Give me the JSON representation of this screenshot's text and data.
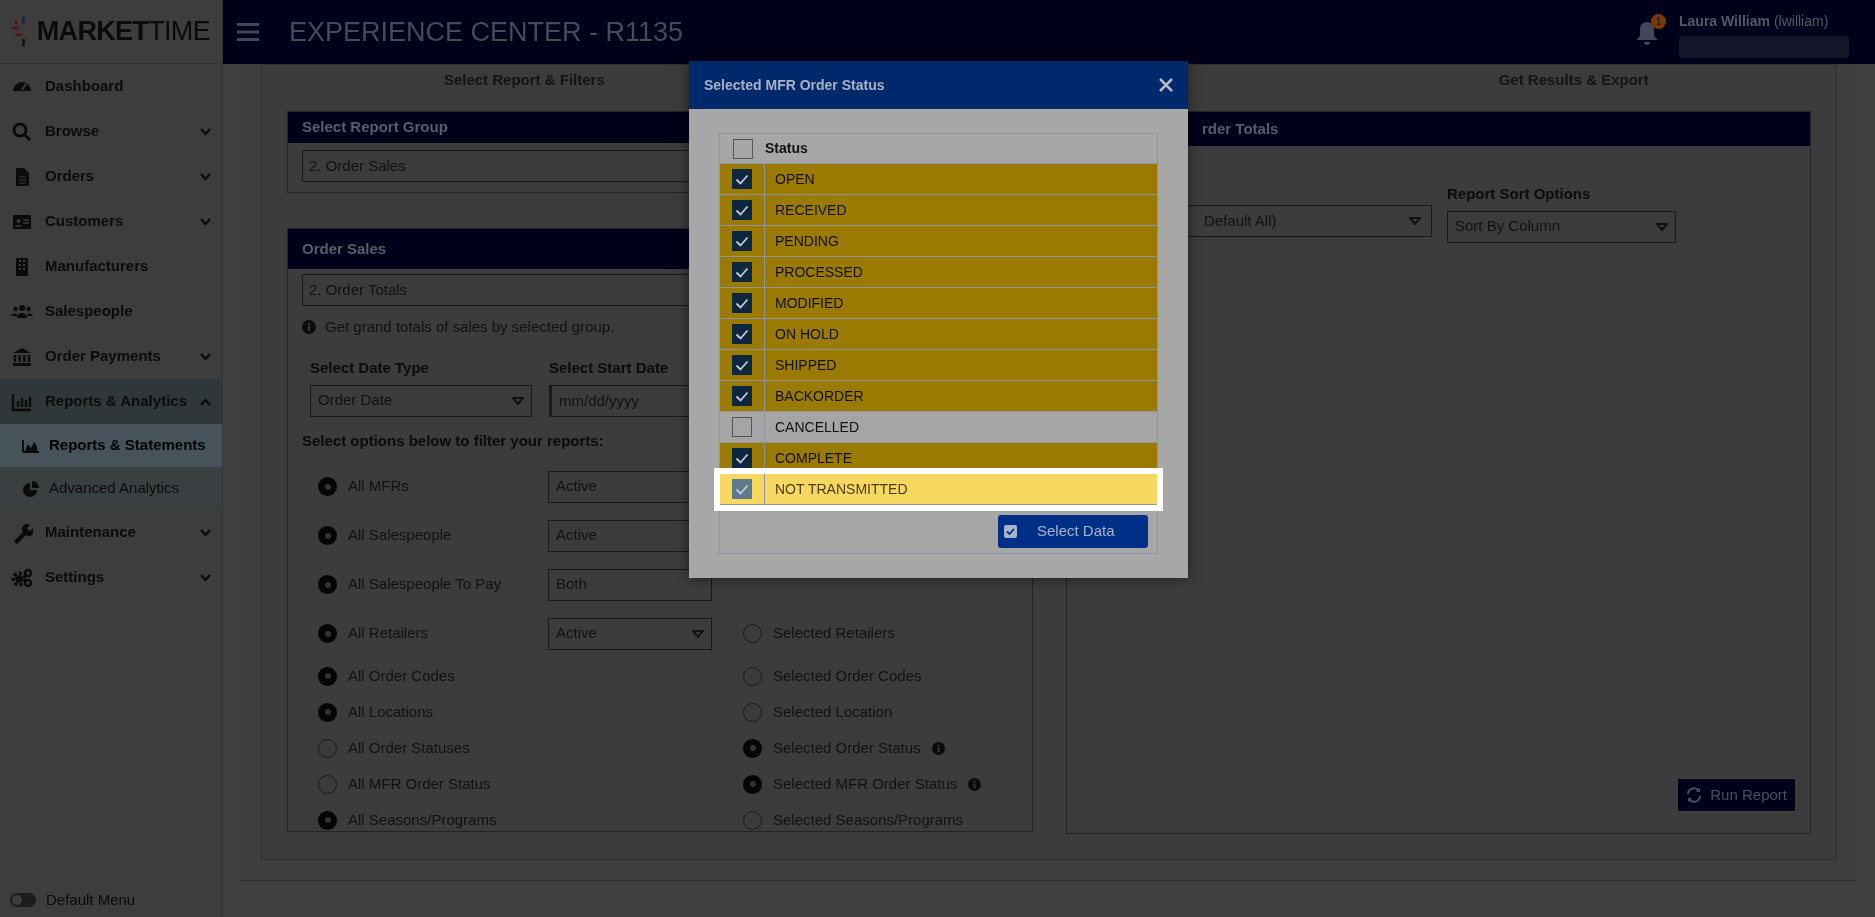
{
  "logo": "**MARKET**TIME",
  "header": {
    "title": "EXPERIENCE CENTER - R1135",
    "notifications": "1",
    "user": "Laura William",
    "username": "(lwilliam)"
  },
  "sidebar": {
    "items": [
      {
        "label": "Dashboard",
        "expandable": false,
        "expanded": false
      },
      {
        "label": "Browse",
        "expandable": true,
        "expanded": false
      },
      {
        "label": "Orders",
        "expandable": true,
        "expanded": false
      },
      {
        "label": "Customers",
        "expandable": true,
        "expanded": false
      },
      {
        "label": "Manufacturers",
        "expandable": false,
        "expanded": false
      },
      {
        "label": "Salespeople",
        "expandable": false,
        "expanded": false
      },
      {
        "label": "Order Payments",
        "expandable": true,
        "expanded": false
      },
      {
        "label": "Reports & Analytics",
        "expandable": true,
        "expanded": true,
        "children": [
          {
            "label": "Reports & Statements",
            "selected": true
          },
          {
            "label": "Advanced Analytics",
            "selected": false
          }
        ]
      },
      {
        "label": "Maintenance",
        "expandable": true,
        "expanded": false
      },
      {
        "label": "Settings",
        "expandable": true,
        "expanded": false
      }
    ],
    "toggle": {
      "label": "Default Menu",
      "on": false
    }
  },
  "steps": [
    "Select Report & Filters",
    "Get Results & Export"
  ],
  "report_group": {
    "title": "Select Report Group",
    "value": "2. Order Sales"
  },
  "order_sales": {
    "title": "Order Sales",
    "report": "2. Order Totals",
    "info": "Get grand totals of sales by selected group.",
    "date_type": {
      "label": "Select Date Type",
      "value": "Order Date"
    },
    "start_date": {
      "label": "Select Start Date",
      "placeholder": "mm/dd/yyyy"
    },
    "filter_heading": "Select options below to filter your reports:",
    "filters": [
      {
        "all": {
          "label": "All MFRs",
          "selected": true
        },
        "select": {
          "value": "Active"
        }
      },
      {
        "all": {
          "label": "All Salespeople",
          "selected": true
        },
        "select": {
          "value": "Active"
        }
      },
      {
        "all": {
          "label": "All Salespeople To Pay",
          "selected": true
        },
        "select": {
          "value": "Both"
        }
      },
      {
        "all": {
          "label": "All Retailers",
          "selected": true
        },
        "select": {
          "value": "Active",
          "caret": true
        },
        "chosen": {
          "label": "Selected Retailers",
          "selected": false,
          "info": false
        }
      },
      {
        "all": {
          "label": "All Order Codes",
          "selected": true
        },
        "chosen": {
          "label": "Selected Order Codes",
          "selected": false,
          "info": false
        }
      },
      {
        "all": {
          "label": "All Locations",
          "selected": true
        },
        "chosen": {
          "label": "Selected Location",
          "selected": false,
          "info": false
        }
      },
      {
        "all": {
          "label": "All Order Statuses",
          "selected": false
        },
        "chosen": {
          "label": "Selected Order Status",
          "selected": true,
          "info": true
        }
      },
      {
        "all": {
          "label": "All MFR Order Status",
          "selected": false
        },
        "chosen": {
          "label": "Selected MFR Order Status",
          "selected": true,
          "info": true
        }
      },
      {
        "all": {
          "label": "All Seasons/Programs",
          "selected": true
        },
        "chosen": {
          "label": "Selected Seasons/Programs",
          "selected": false,
          "info": false
        }
      }
    ]
  },
  "order_totals": {
    "title": "rder Totals",
    "group_value": "Default All)",
    "sort": {
      "label": "Report Sort Options",
      "value": "Sort By Column"
    },
    "run_button": "Run Report"
  },
  "modal": {
    "title": "Selected MFR Order Status",
    "column": "Status",
    "all_checked": false,
    "button": "Select Data",
    "rows": [
      {
        "label": "OPEN",
        "checked": true,
        "highlighted": false
      },
      {
        "label": "RECEIVED",
        "checked": true,
        "highlighted": false
      },
      {
        "label": "PENDING",
        "checked": true,
        "highlighted": false
      },
      {
        "label": "PROCESSED",
        "checked": true,
        "highlighted": false
      },
      {
        "label": "MODIFIED",
        "checked": true,
        "highlighted": false
      },
      {
        "label": "ON HOLD",
        "checked": true,
        "highlighted": false
      },
      {
        "label": "SHIPPED",
        "checked": true,
        "highlighted": false
      },
      {
        "label": "BACKORDER",
        "checked": true,
        "highlighted": false
      },
      {
        "label": "CANCELLED",
        "checked": false,
        "highlighted": false
      },
      {
        "label": "COMPLETE",
        "checked": true,
        "highlighted": false
      },
      {
        "label": "NOT TRANSMITTED",
        "checked": true,
        "highlighted": true
      }
    ]
  }
}
